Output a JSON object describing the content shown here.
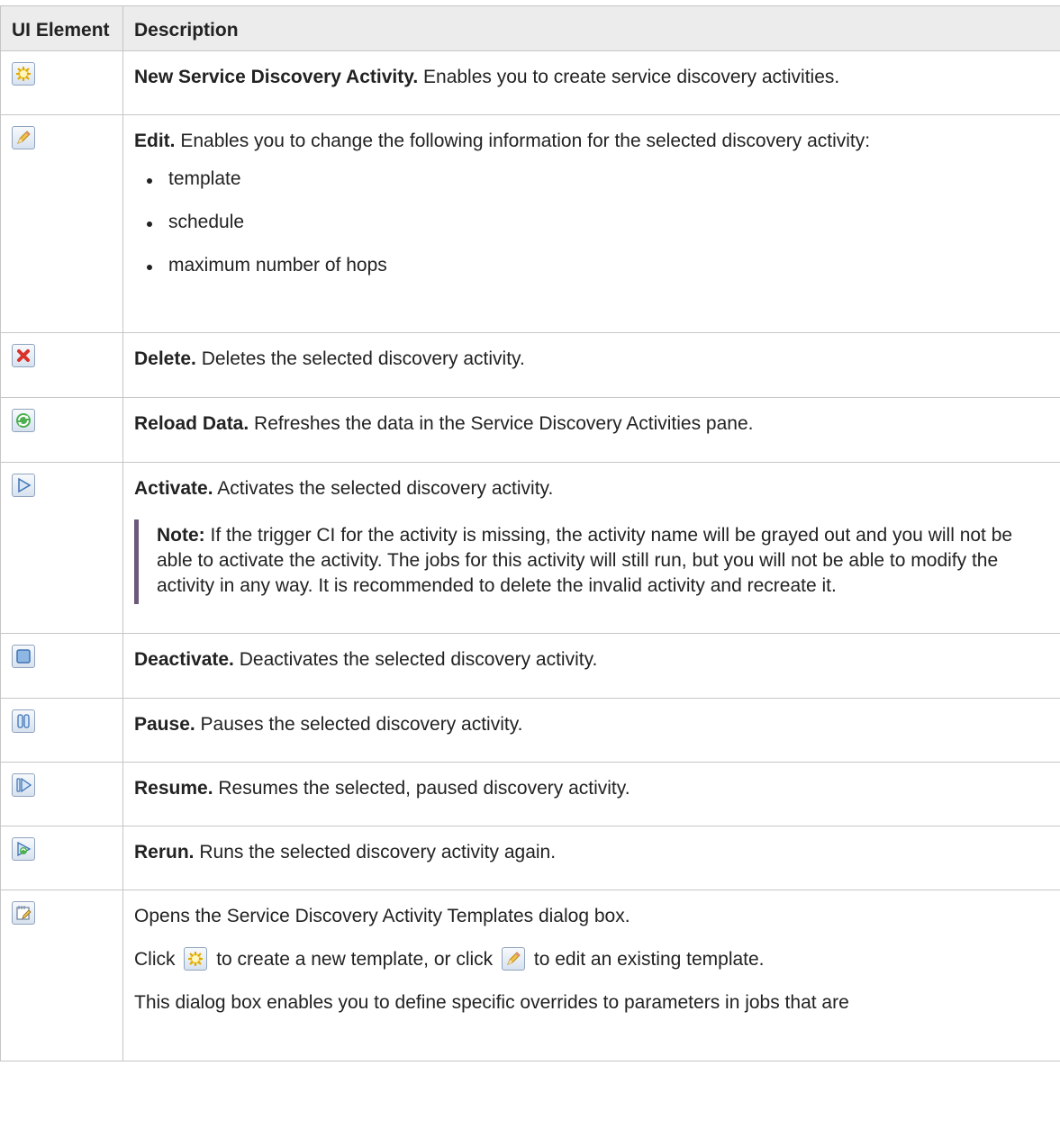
{
  "header": {
    "col1": "UI Element",
    "col2": "Description"
  },
  "rows": [
    {
      "icon": "new-activity-icon",
      "term": "New Service Discovery Activity.",
      "text": " Enables you to create service discovery activities."
    },
    {
      "icon": "edit-icon",
      "term": "Edit.",
      "text": " Enables you to change the following information for the selected discovery activity:",
      "bullets": [
        "template",
        "schedule",
        "maximum number of hops"
      ]
    },
    {
      "icon": "delete-icon",
      "term": "Delete.",
      "text": " Deletes the selected discovery activity."
    },
    {
      "icon": "reload-icon",
      "term": "Reload Data.",
      "text": " Refreshes the data in the Service Discovery Activities pane."
    },
    {
      "icon": "activate-icon",
      "term": "Activate.",
      "text": " Activates the selected discovery activity.",
      "note_label": "Note:",
      "note_text": " If the trigger CI for the activity is missing, the activity name will be grayed out and you will not be able to activate the activity. The jobs for this activity will still run, but you will not be able to modify the activity in any way. It is recommended to delete the invalid activity and recreate it."
    },
    {
      "icon": "deactivate-icon",
      "term": "Deactivate.",
      "text": " Deactivates the selected discovery activity."
    },
    {
      "icon": "pause-icon",
      "term": "Pause.",
      "text": " Pauses the selected discovery activity."
    },
    {
      "icon": "resume-icon",
      "term": "Resume.",
      "text": " Resumes the selected, paused discovery activity."
    },
    {
      "icon": "rerun-icon",
      "term": "Rerun.",
      "text": " Runs the selected discovery activity again."
    },
    {
      "icon": "templates-icon",
      "p1": "Opens the Service Discovery Activity Templates dialog box.",
      "p2_a": "Click",
      "p2_b": "to create a new template, or click",
      "p2_c": "to edit an existing template.",
      "p3": "This dialog box enables you to define specific overrides to parameters in jobs that are"
    }
  ]
}
